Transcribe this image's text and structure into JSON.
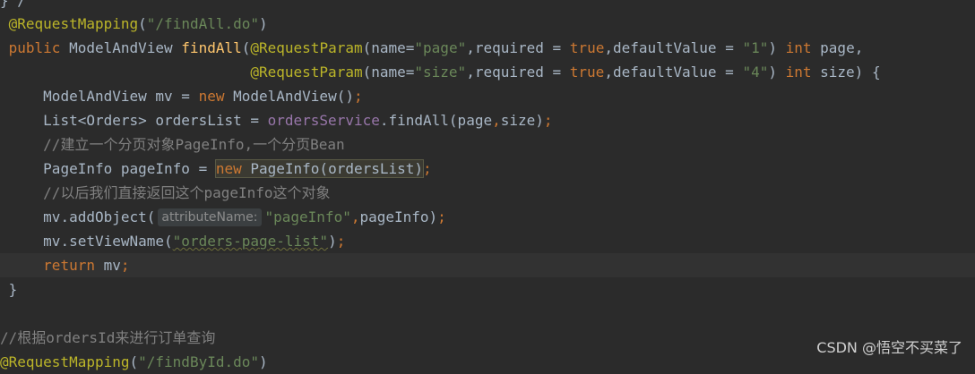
{
  "code": {
    "l0": "} /",
    "l1": {
      "ann": "@RequestMapping",
      "open": "(",
      "str": "\"/findAll.do\"",
      "close": ")"
    },
    "l2": {
      "kw_public": "public",
      "type": " ModelAndView ",
      "method": "findAll",
      "paren": "(",
      "ann": "@RequestParam",
      "p_open": "(name=",
      "s_name": "\"page\"",
      "req": ",required = ",
      "kw_true": "true",
      "def": ",defaultValue = ",
      "s_val": "\"1\"",
      "p_close": ") ",
      "kw_int": "int",
      "param": " page,"
    },
    "l3": {
      "indent": "                            ",
      "ann": "@RequestParam",
      "p_open": "(name=",
      "s_name": "\"size\"",
      "req": ",required = ",
      "kw_true": "true",
      "def": ",defaultValue = ",
      "s_val": "\"4\"",
      "p_close": ") ",
      "kw_int": "int",
      "param": " size) {"
    },
    "l4": {
      "a": "    ModelAndView mv = ",
      "kw_new": "new",
      "b": " ModelAndView()",
      "semi": ";"
    },
    "l5": {
      "a": "    List<Orders> ordersList = ",
      "field": "ordersService",
      "b": ".findAll(page",
      "comma": ",",
      "c": "size)",
      "semi": ";"
    },
    "l6": "    //建立一个分页对象PageInfo,一个分页Bean",
    "l7": {
      "a": "    PageInfo pageInfo = ",
      "kw_new": "new",
      "b": " PageInfo(ordersList)",
      "semi": ";"
    },
    "l8": "    //以后我们直接返回这个pageInfo这个对象",
    "l9": {
      "a": "    mv.addObject(",
      "hint": "attributeName:",
      "str": "\"pageInfo\"",
      "comma": ",",
      "b": "pageInfo)",
      "semi": ";"
    },
    "l10": {
      "a": "    mv.setViewName(",
      "str": "\"orders-page-list\"",
      "b": ")",
      "semi": ";"
    },
    "l11": {
      "indent": "    ",
      "kw_return": "return",
      "b": " mv",
      "semi": ";"
    },
    "l12": "}",
    "l14": "//根据ordersId来进行订单查询",
    "l15": {
      "ann": "@RequestMapping",
      "open": "(",
      "str": "\"/findById.do\"",
      "close": ")"
    }
  },
  "watermark": "CSDN @悟空不买菜了",
  "colors": {
    "background": "#2b2b2b",
    "current_line": "#323232",
    "annotation": "#bbb529",
    "keyword": "#cc7832",
    "string": "#6a8759",
    "number": "#6897bb",
    "method": "#ffc66d",
    "field": "#9876aa",
    "comment": "#808080",
    "text": "#a9b7c6"
  }
}
